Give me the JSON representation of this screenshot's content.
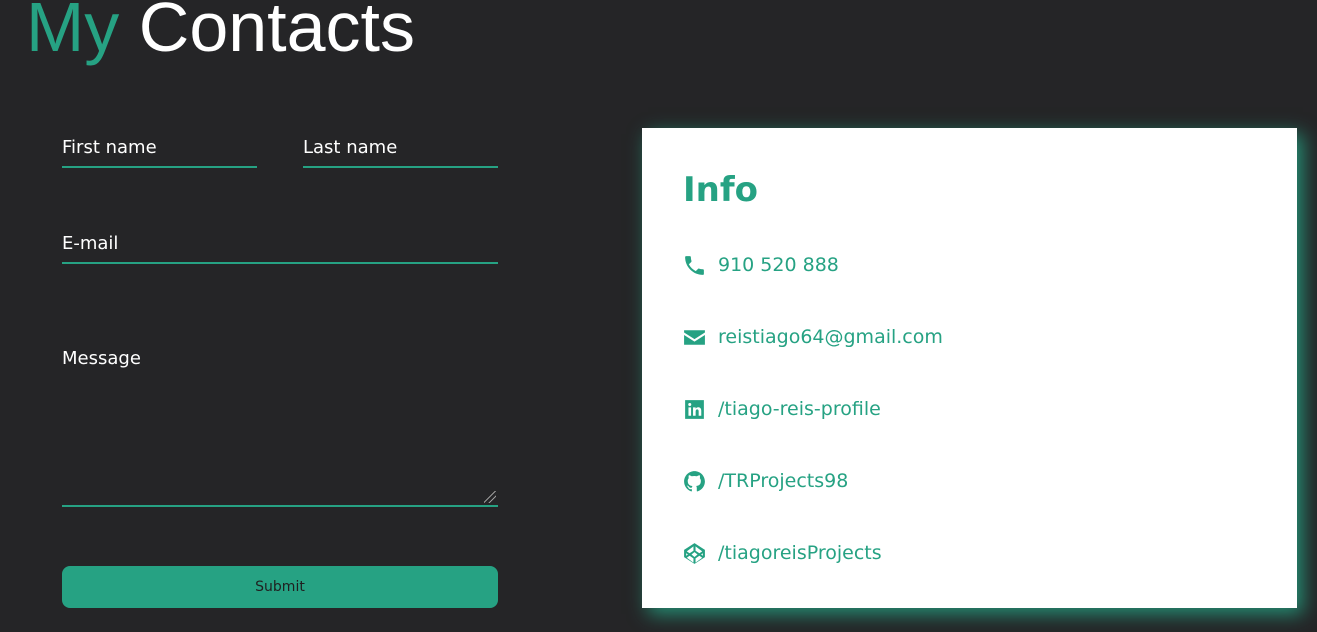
{
  "header": {
    "title_accent": "My",
    "title_rest": "Contacts"
  },
  "form": {
    "first_name_placeholder": "First name",
    "last_name_placeholder": "Last name",
    "email_placeholder": "E-mail",
    "message_placeholder": "Message",
    "submit_label": "Submit"
  },
  "info": {
    "title": "Info",
    "items": [
      {
        "icon": "phone-icon",
        "text": "910 520 888"
      },
      {
        "icon": "envelope-icon",
        "text": "reistiago64@gmail.com"
      },
      {
        "icon": "linkedin-icon",
        "text": "/tiago-reis-profile"
      },
      {
        "icon": "github-icon",
        "text": "/TRProjects98"
      },
      {
        "icon": "codepen-icon",
        "text": "/tiagoreisProjects"
      }
    ]
  },
  "colors": {
    "accent": "#26a283",
    "background": "#252527",
    "card": "#ffffff"
  }
}
